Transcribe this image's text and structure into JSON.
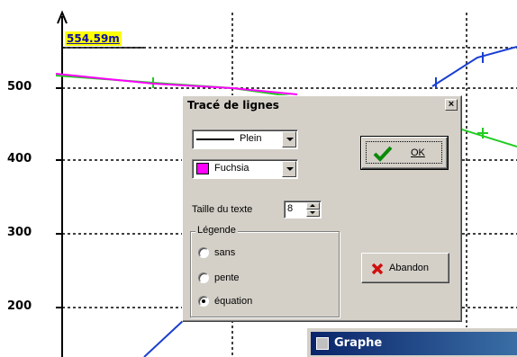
{
  "plot": {
    "y_ticks": [
      "500",
      "400",
      "300",
      "200"
    ],
    "value_label": "554.59m",
    "colors": {
      "magenta_line": "#ff00ff",
      "green_line": "#22cc22",
      "blue_line": "#1a3fd0",
      "label_bg": "#ffff00"
    }
  },
  "dialog": {
    "title": "Tracé de lignes",
    "close_label": "×",
    "line_style": {
      "selected": "Plein"
    },
    "color": {
      "selected": "Fuchsia",
      "swatch": "#ff00ff"
    },
    "text_size": {
      "label": "Taille du texte",
      "value": "8"
    },
    "legend": {
      "label": "Légende",
      "options": [
        {
          "label": "sans",
          "checked": false
        },
        {
          "label": "pente",
          "checked": false
        },
        {
          "label": "équation",
          "checked": true
        }
      ]
    },
    "ok_button": {
      "label": "OK",
      "icon": "checkmark-icon"
    },
    "abandon_button": {
      "label": "Abandon",
      "icon": "cross-icon"
    }
  },
  "background_window": {
    "title": "Graphe"
  }
}
